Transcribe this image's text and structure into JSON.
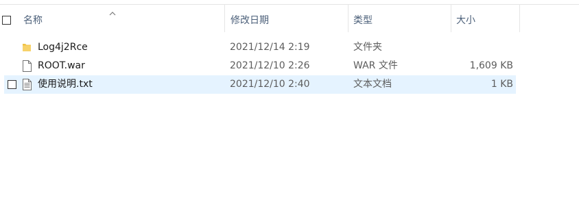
{
  "columns": {
    "name": "名称",
    "modified": "修改日期",
    "type": "类型",
    "size": "大小"
  },
  "files": [
    {
      "name": "Log4j2Rce",
      "modified": "2021/12/14 2:19",
      "type": "文件夹",
      "size": "",
      "icon": "folder-icon"
    },
    {
      "name": "ROOT.war",
      "modified": "2021/12/10 2:26",
      "type": "WAR 文件",
      "size": "1,609 KB",
      "icon": "blank-file-icon"
    },
    {
      "name": "使用说明.txt",
      "modified": "2021/12/10 2:40",
      "type": "文本文档",
      "size": "1 KB",
      "icon": "text-file-icon"
    }
  ],
  "colors": {
    "hover_row": "#e5f3ff",
    "header_text": "#4c607a",
    "separator": "#e5e5e5",
    "folder": "#f0c246"
  }
}
